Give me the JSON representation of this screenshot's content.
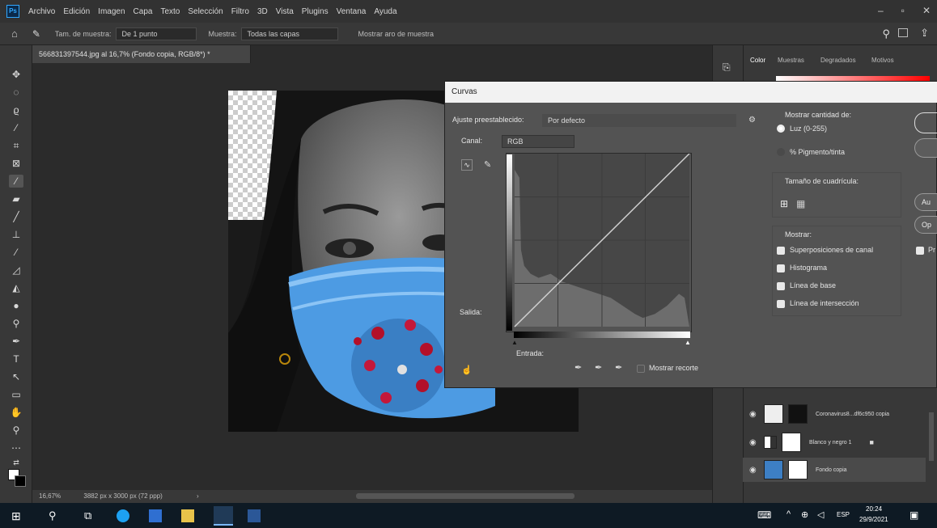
{
  "menubar": {
    "app_icon": "Ps",
    "items": [
      "Archivo",
      "Edición",
      "Imagen",
      "Capa",
      "Texto",
      "Selección",
      "Filtro",
      "3D",
      "Vista",
      "Plugins",
      "Ventana",
      "Ayuda"
    ]
  },
  "options": {
    "sample_size_label": "Tam. de muestra:",
    "sample_size_value": "De 1 punto",
    "sample_label": "Muestra:",
    "sample_value": "Todas las capas",
    "ring_label": "Mostrar aro de muestra"
  },
  "document": {
    "tab_title": "566831397544.jpg al 16,7% (Fondo copia, RGB/8*) *",
    "zoom": "16,67%",
    "size": "3882 px x 3000 px (72 ppp)"
  },
  "right_panel": {
    "tabs": [
      "Color",
      "Muestras",
      "Degradados",
      "Motivos"
    ]
  },
  "layers": [
    {
      "name": "Coronavirus8...df6c950 copia"
    },
    {
      "name": "Blanco y negro 1"
    },
    {
      "name": "Fondo copia"
    }
  ],
  "curves": {
    "title": "Curvas",
    "preset_label": "Ajuste preestablecido:",
    "preset_value": "Por defecto",
    "channel_label": "Canal:",
    "channel_value": "RGB",
    "output_label": "Salida:",
    "input_label": "Entrada:",
    "show_amount_label": "Mostrar cantidad de:",
    "light_option": "Luz (0-255)",
    "pigment_option": "% Pigmento/tinta",
    "grid_size_label": "Tamaño de cuadrícula:",
    "show_label": "Mostrar:",
    "checkboxes": [
      "Superposiciones de canal",
      "Histograma",
      "Línea de base",
      "Línea de intersección"
    ],
    "show_clipping": "Mostrar recorte",
    "side_buttons": [
      "Au",
      "Op"
    ],
    "side_check": "Pr"
  },
  "taskbar": {
    "lang": "ESP",
    "time": "20:24",
    "date": "29/9/2021"
  }
}
